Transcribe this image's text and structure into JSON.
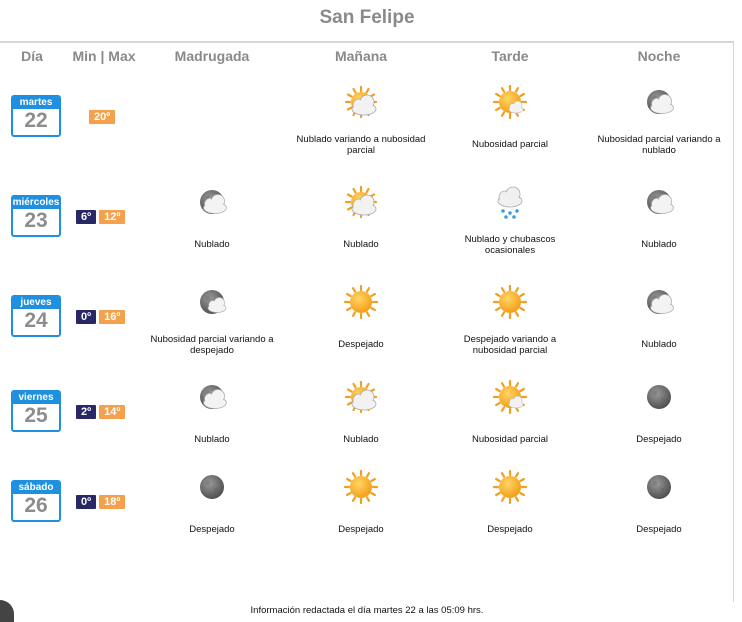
{
  "title": "San Felipe",
  "headers": [
    "Día",
    "Min | Max",
    "Madrugada",
    "Mañana",
    "Tarde",
    "Noche"
  ],
  "days": [
    {
      "day": "martes",
      "date": "22",
      "min": "",
      "max": "20º",
      "periods": [
        null,
        {
          "icon": "partly-cloudy-icon",
          "text": "Nublado variando a nubosidad parcial"
        },
        {
          "icon": "partly-sunny-icon",
          "text": "Nubosidad parcial"
        },
        {
          "icon": "night-cloudy-icon",
          "text": "Nubosidad parcial variando a nublado"
        }
      ]
    },
    {
      "day": "miércoles",
      "date": "23",
      "min": "6º",
      "max": "12º",
      "periods": [
        {
          "icon": "night-cloudy-icon",
          "text": "Nublado"
        },
        {
          "icon": "partly-cloudy-icon",
          "text": "Nublado"
        },
        {
          "icon": "rain-showers-icon",
          "text": "Nublado y chubascos ocasionales"
        },
        {
          "icon": "night-cloudy-icon",
          "text": "Nublado"
        }
      ]
    },
    {
      "day": "jueves",
      "date": "24",
      "min": "0º",
      "max": "16º",
      "periods": [
        {
          "icon": "night-partly-cloudy-icon",
          "text": "Nubosidad parcial variando a despejado"
        },
        {
          "icon": "sun-icon",
          "text": "Despejado"
        },
        {
          "icon": "sun-icon",
          "text": "Despejado variando a nubosidad parcial"
        },
        {
          "icon": "night-cloudy-icon",
          "text": "Nublado"
        }
      ]
    },
    {
      "day": "viernes",
      "date": "25",
      "min": "2º",
      "max": "14º",
      "periods": [
        {
          "icon": "night-cloudy-icon",
          "text": "Nublado"
        },
        {
          "icon": "partly-cloudy-icon",
          "text": "Nublado"
        },
        {
          "icon": "partly-sunny-icon",
          "text": "Nubosidad parcial"
        },
        {
          "icon": "moon-icon",
          "text": "Despejado"
        }
      ]
    },
    {
      "day": "sábado",
      "date": "26",
      "min": "0º",
      "max": "18º",
      "periods": [
        {
          "icon": "moon-icon",
          "text": "Despejado"
        },
        {
          "icon": "sun-icon",
          "text": "Despejado"
        },
        {
          "icon": "sun-icon",
          "text": "Despejado"
        },
        {
          "icon": "moon-icon",
          "text": "Despejado"
        }
      ]
    }
  ],
  "footer": "Información redactada el día martes 22 a las 05:09 hrs.",
  "colors": {
    "calendar_blue": "#1f8fe0",
    "min_badge": "#2a2766",
    "max_badge": "#f4a04c",
    "header_gray": "#8a8a8a"
  }
}
